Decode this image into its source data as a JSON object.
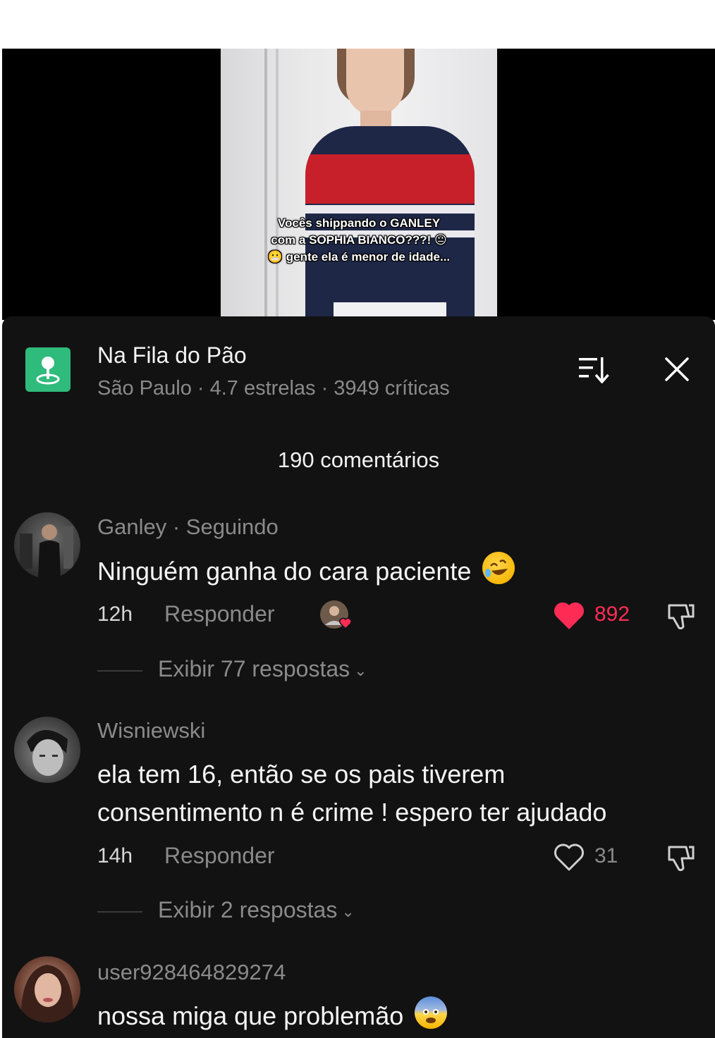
{
  "video": {
    "caption_lines": [
      "Vocês shippando o GANLEY",
      "com a SOPHIA BIANCO???! 😐",
      "😬 gente ela é menor de idade..."
    ]
  },
  "place": {
    "name": "Na Fila do Pão",
    "meta": "São Paulo · 4.7 estrelas · 3949 críticas",
    "icon": "map-pin-icon",
    "icon_color": "#2fbb7b"
  },
  "header": {
    "sort_icon": "sort-icon",
    "close_icon": "close-icon",
    "comments_count": "190 comentários"
  },
  "comments": [
    {
      "username": "Ganley · Seguindo",
      "text": "Ninguém ganha do cara paciente",
      "emoji": "rolling-on-floor-laughing-emoji",
      "time": "12h",
      "reply_label": "Responder",
      "likes": "892",
      "liked": true,
      "liked_by_creator": true,
      "view_replies": "Exibir 77 respostas"
    },
    {
      "username": "Wisniewski",
      "text_lines": [
        "ela tem 16, então se os pais tiverem",
        "consentimento n é crime ! espero ter ajudado"
      ],
      "time": "14h",
      "reply_label": "Responder",
      "likes": "31",
      "liked": false,
      "view_replies": "Exibir 2 respostas"
    },
    {
      "username": "user928464829274",
      "text": "nossa miga que problemão",
      "emoji": "fearful-face-emoji"
    }
  ],
  "colors": {
    "sheet_bg": "#121212",
    "like_red": "#fe2c55",
    "muted_text": "#8a8a8a"
  }
}
